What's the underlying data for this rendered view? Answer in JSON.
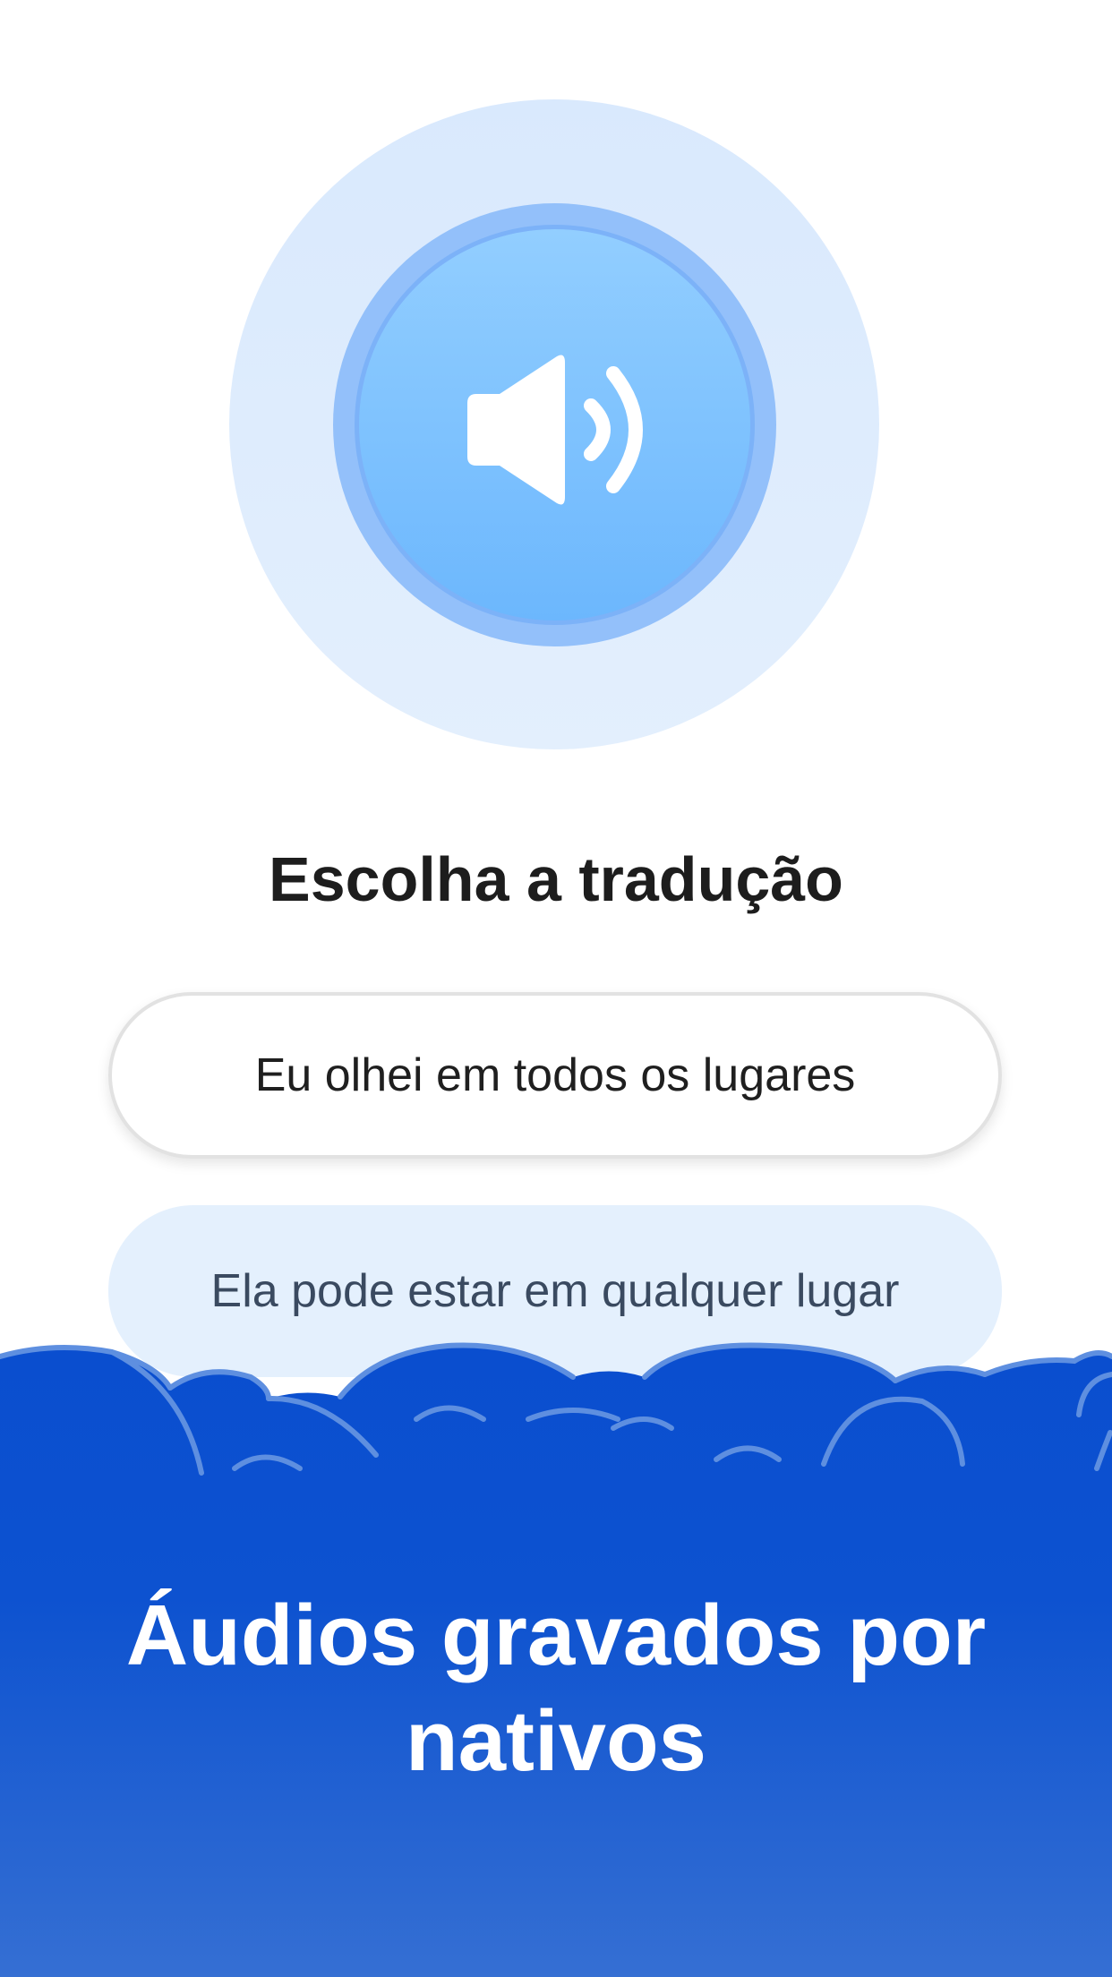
{
  "audio": {
    "icon": "speaker-volume-icon"
  },
  "question": {
    "title": "Escolha a tradução"
  },
  "options": [
    {
      "label": "Eu olhei em todos os lugares"
    },
    {
      "label": "Ela pode estar em qualquer lugar"
    }
  ],
  "promo": {
    "text": "Áudios gravados por nativos"
  },
  "colors": {
    "halo": "#dceafd",
    "play_button": "#7fbffc",
    "brand_blue": "#0a4fd0",
    "option_selected_bg": "#e4f0fd"
  }
}
